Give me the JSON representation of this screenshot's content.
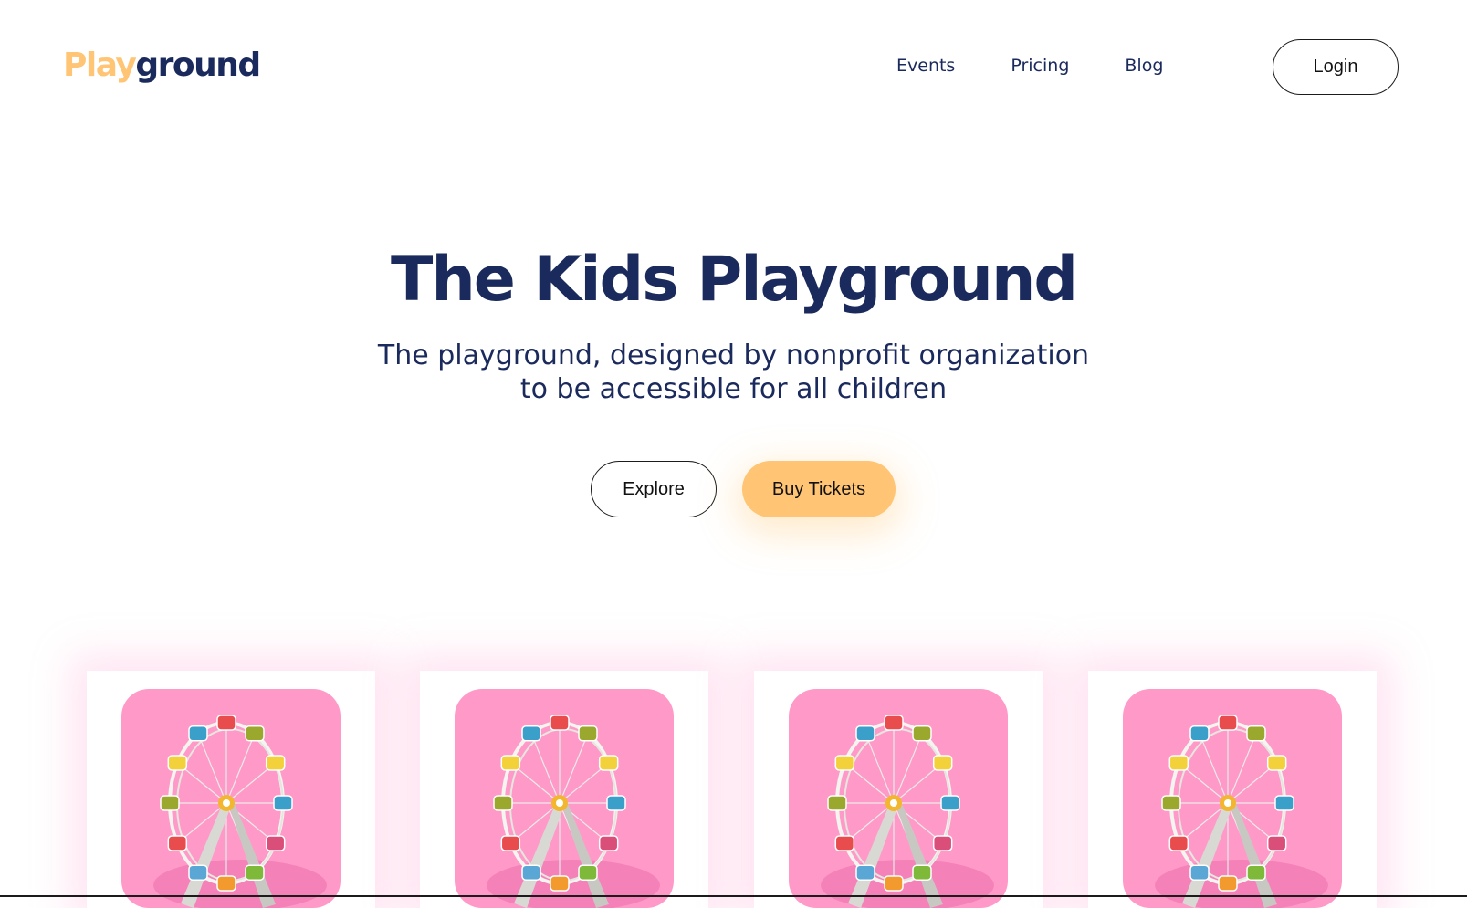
{
  "header": {
    "logo": {
      "part1": "Play",
      "part2": "ground"
    },
    "nav": [
      {
        "label": "Events"
      },
      {
        "label": "Pricing"
      },
      {
        "label": "Blog"
      }
    ],
    "login_label": "Login"
  },
  "hero": {
    "title": "The Kids Playground",
    "subtitle_line1": "The playground, designed by nonprofit organization",
    "subtitle_line2": "to be accessible for all children",
    "explore_label": "Explore",
    "buy_label": "Buy Tickets"
  },
  "cards": [
    {
      "image": "ferris-wheel-illustration"
    },
    {
      "image": "ferris-wheel-illustration"
    },
    {
      "image": "ferris-wheel-illustration"
    },
    {
      "image": "ferris-wheel-illustration"
    }
  ],
  "colors": {
    "brand_navy": "#1b2a5c",
    "accent_yellow": "#ffc574",
    "card_pink": "#ff9ac8"
  }
}
